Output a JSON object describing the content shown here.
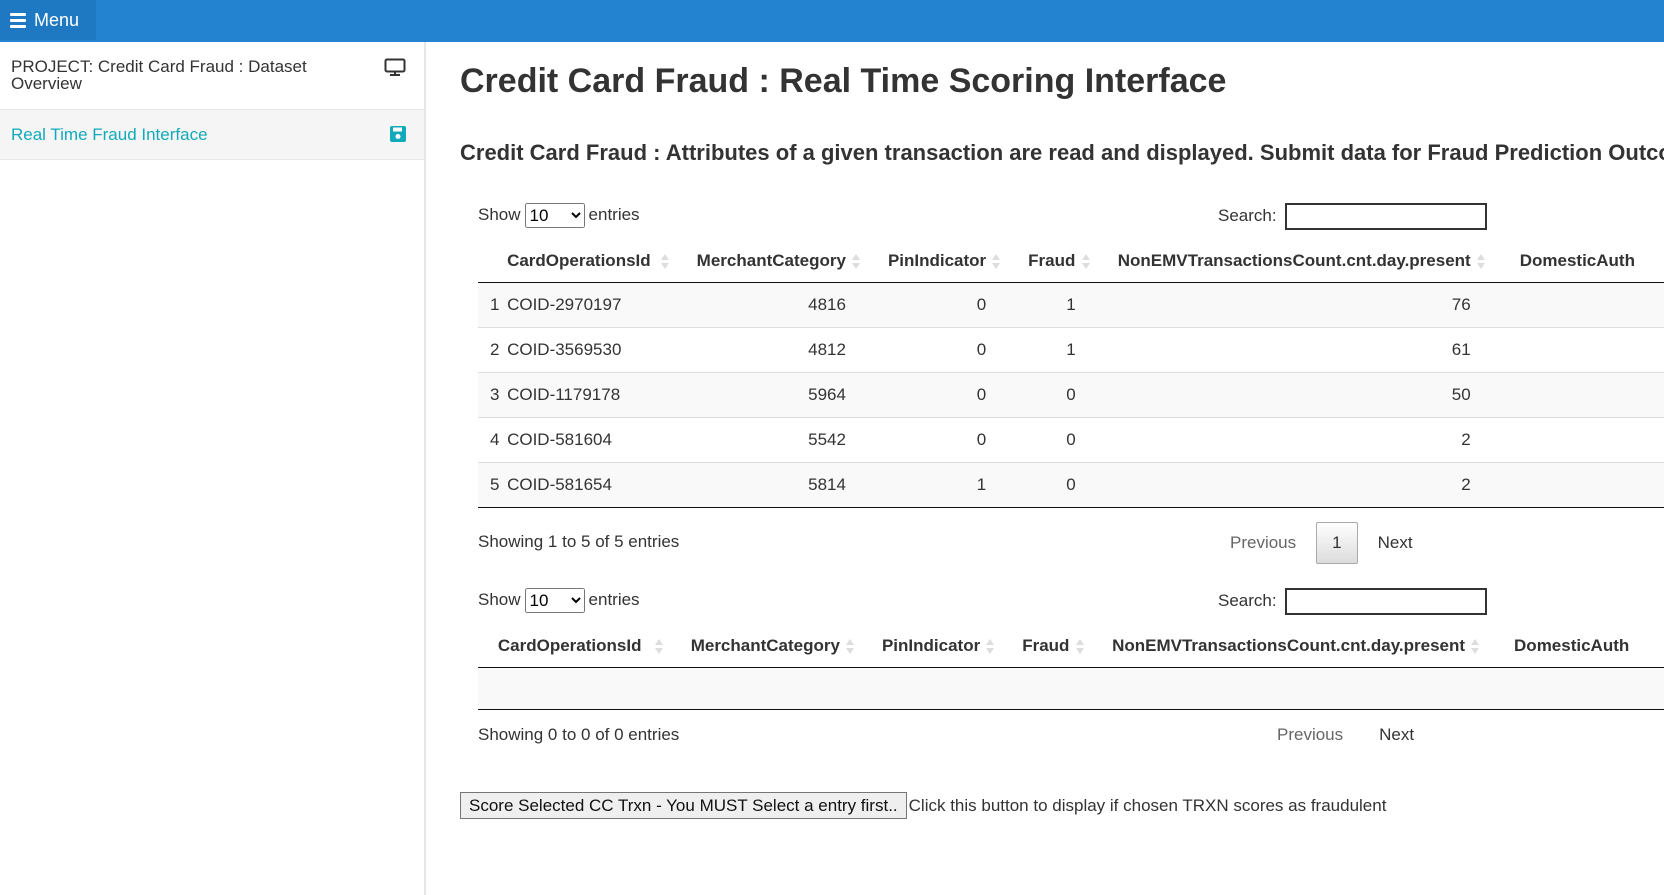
{
  "topbar": {
    "menu_label": "Menu",
    "color": "#2383d0"
  },
  "sidebar": {
    "items": [
      {
        "label": "PROJECT: Credit Card Fraud : Dataset Overview",
        "icon": "monitor-icon",
        "active": false
      },
      {
        "label": "Real Time Fraud Interface",
        "icon": "save-icon",
        "active": true
      }
    ],
    "active_color": "#12aabb"
  },
  "main": {
    "title": "Credit Card Fraud : Real Time Scoring Interface",
    "subtitle": "Credit Card Fraud : Attributes of a given transaction are read and displayed. Submit data for Fraud Prediction Outcome"
  },
  "table1": {
    "show_label": "Show",
    "entries_label": "entries",
    "length_value": "10",
    "search_label": "Search:",
    "search_value": "",
    "columns": [
      "CardOperationsId",
      "MerchantCategory",
      "PinIndicator",
      "Fraud",
      "NonEMVTransactionsCount.cnt.day.present",
      "DomesticAuth"
    ],
    "rows": [
      {
        "idx": "1",
        "id": "COID-2970197",
        "merchant": "4816",
        "pin": "0",
        "fraud": "1",
        "nonemv": "76"
      },
      {
        "idx": "2",
        "id": "COID-3569530",
        "merchant": "4812",
        "pin": "0",
        "fraud": "1",
        "nonemv": "61"
      },
      {
        "idx": "3",
        "id": "COID-1179178",
        "merchant": "5964",
        "pin": "0",
        "fraud": "0",
        "nonemv": "50"
      },
      {
        "idx": "4",
        "id": "COID-581604",
        "merchant": "5542",
        "pin": "0",
        "fraud": "0",
        "nonemv": "2"
      },
      {
        "idx": "5",
        "id": "COID-581654",
        "merchant": "5814",
        "pin": "1",
        "fraud": "0",
        "nonemv": "2"
      }
    ],
    "info": "Showing 1 to 5 of 5 entries",
    "previous_label": "Previous",
    "current_page": "1",
    "next_label": "Next"
  },
  "table2": {
    "show_label": "Show",
    "entries_label": "entries",
    "length_value": "10",
    "search_label": "Search:",
    "search_value": "",
    "columns": [
      "CardOperationsId",
      "MerchantCategory",
      "PinIndicator",
      "Fraud",
      "NonEMVTransactionsCount.cnt.day.present",
      "DomesticAuth"
    ],
    "info": "Showing 0 to 0 of 0 entries",
    "previous_label": "Previous",
    "next_label": "Next"
  },
  "score": {
    "button_label": "Score Selected CC Trxn - You MUST Select a entry first..",
    "note": "Click this button to display if chosen TRXN scores as fraudulent"
  }
}
